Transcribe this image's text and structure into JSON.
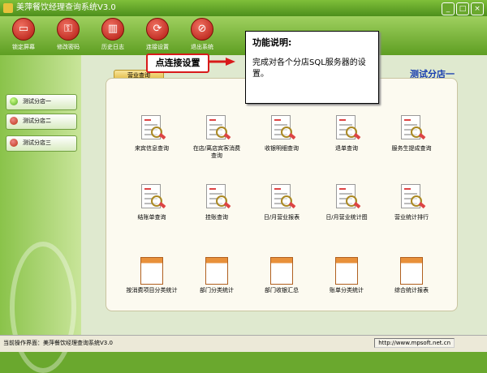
{
  "window": {
    "title": "美萍餐饮经理查询系统V3.0"
  },
  "toolbar": [
    {
      "label": "锁定屏幕",
      "icon": "monitor-icon"
    },
    {
      "label": "修改密码",
      "icon": "key-icon"
    },
    {
      "label": "历史日志",
      "icon": "book-icon"
    },
    {
      "label": "连接设置",
      "icon": "connect-icon"
    },
    {
      "label": "退出系统",
      "icon": "exit-icon"
    }
  ],
  "sidebar": {
    "items": [
      "测试分店一",
      "测试分店二",
      "测试分店三"
    ]
  },
  "main": {
    "tab": "营业查询",
    "branch": "测试分店一",
    "items": [
      "来宾信息查询",
      "在店/离店宾客消费查询",
      "收银明细查询",
      "退单查询",
      "服务生提成查询",
      "结账单查询",
      "挂账查询",
      "日/月营业报表",
      "日/月营业统计图",
      "营业统计排行",
      "按消费项目分类统计",
      "部门分类统计",
      "部门收银汇总",
      "账单分类统计",
      "综合统计报表"
    ]
  },
  "tooltip": {
    "heading": "功能说明:",
    "body": "完成对各个分店SQL服务器的设置。"
  },
  "callout": {
    "label": "点连接设置"
  },
  "status": {
    "left": "当前操作界面：美萍餐饮经理查询系统V3.0",
    "right": "http://www.mpsoft.net.cn"
  }
}
